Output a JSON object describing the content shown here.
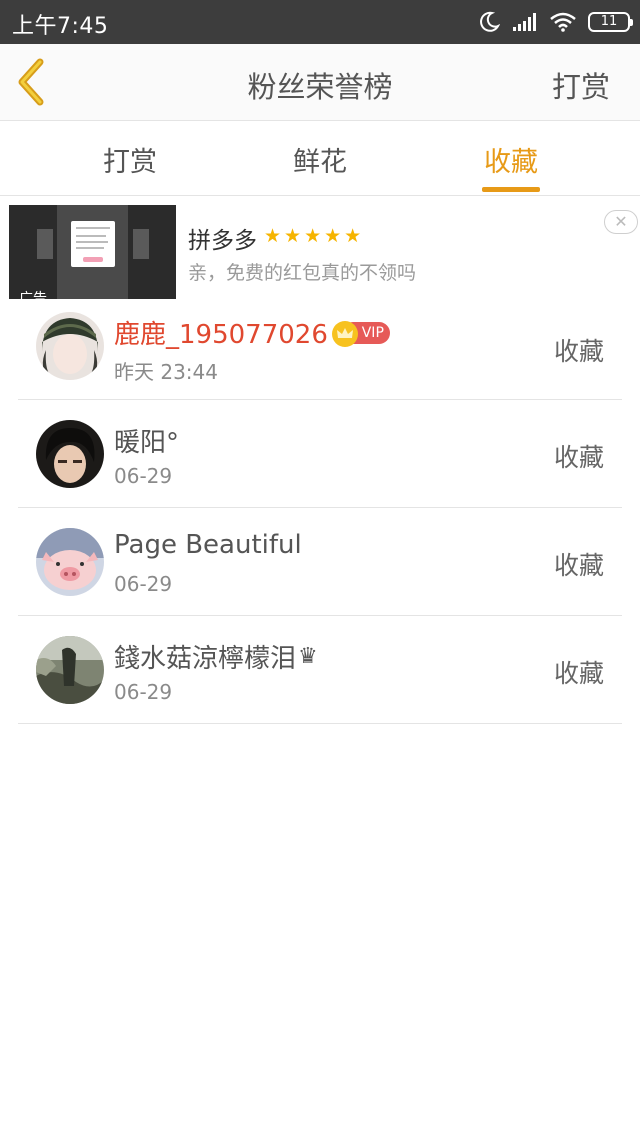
{
  "status_bar": {
    "time": "上午7:45",
    "battery": "11"
  },
  "header": {
    "title": "粉丝荣誉榜",
    "right_action": "打赏"
  },
  "tabs": [
    {
      "label": "打赏",
      "active": false
    },
    {
      "label": "鲜花",
      "active": false
    },
    {
      "label": "收藏",
      "active": true
    }
  ],
  "ad": {
    "title": "拼多多",
    "stars": "★★★★★",
    "description": "亲，免费的红包真的不领吗",
    "label": "广告",
    "close": "✕"
  },
  "fans": [
    {
      "name": "鹿鹿_195077026",
      "time": "昨天 23:44",
      "action": "收藏",
      "vip_label": "VIP"
    },
    {
      "name": "暖阳°",
      "time": "06-29",
      "action": "收藏"
    },
    {
      "name": "Page Beautiful",
      "time": "06-29",
      "action": "收藏"
    },
    {
      "name": "錢水菇涼檸檬泪",
      "time": "06-29",
      "action": "收藏",
      "suffix": "♛"
    }
  ],
  "colors": {
    "accent": "#e79a17",
    "vip_name": "#e0482f",
    "status_bar": "#3d3d3d",
    "star": "#f6b400"
  },
  "icons": [
    "back-chevron-icon",
    "moon-icon",
    "signal-icon",
    "wifi-icon",
    "battery-icon",
    "crown-icon",
    "close-icon"
  ]
}
